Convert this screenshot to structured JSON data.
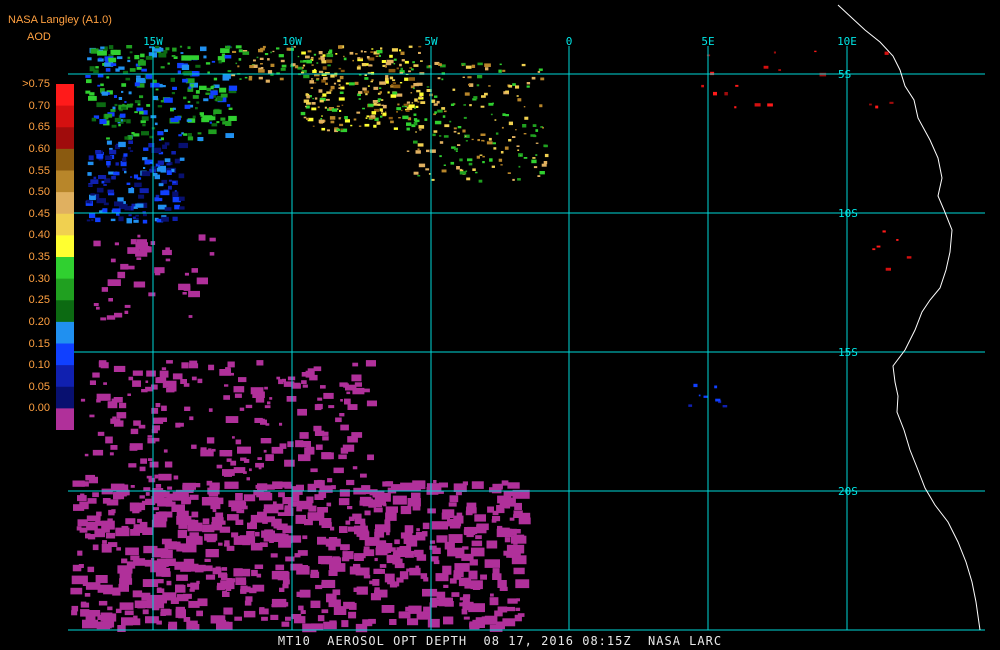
{
  "header": {
    "source": "NASA Langley (A1.0)",
    "product": "AOD"
  },
  "legend": {
    "labels": [
      ">0.75",
      "0.70",
      "0.65",
      "0.60",
      "0.55",
      "0.50",
      "0.45",
      "0.40",
      "0.35",
      "0.30",
      "0.25",
      "0.20",
      "0.15",
      "0.10",
      "0.05",
      "0.00"
    ],
    "colors": [
      "#ff1a1a",
      "#d41010",
      "#a00c0c",
      "#8a5a10",
      "#b8862a",
      "#e0b060",
      "#f0d050",
      "#ffff30",
      "#30d030",
      "#20a020",
      "#0c6a12",
      "#2090f0",
      "#1040ff",
      "#1020b0",
      "#081070",
      "#b0309a"
    ]
  },
  "grid": {
    "longitudes": [
      "15W",
      "10W",
      "5W",
      "0",
      "5E",
      "10E"
    ],
    "latitudes": [
      "5S",
      "10S",
      "15S",
      "20S"
    ]
  },
  "caption": "MT10  AEROSOL OPT DEPTH  08 17, 2016 08:15Z  NASA LARC"
}
